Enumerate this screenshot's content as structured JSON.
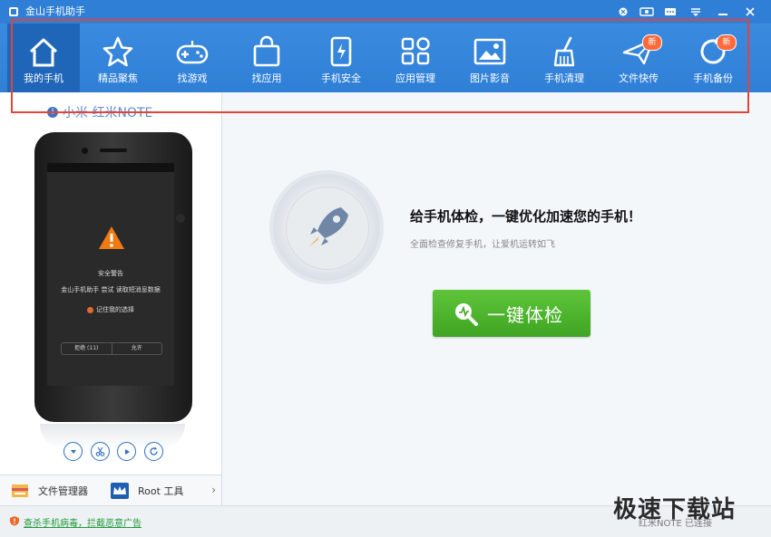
{
  "window": {
    "title": "金山手机助手",
    "controls": [
      "close-circle-icon",
      "skin-icon",
      "message-icon",
      "menu-icon",
      "minimize-icon",
      "close-icon"
    ]
  },
  "toolbar": {
    "items": [
      {
        "label": "我的手机",
        "icon": "home-icon",
        "active": true
      },
      {
        "label": "精品聚焦",
        "icon": "star-icon"
      },
      {
        "label": "找游戏",
        "icon": "gamepad-icon"
      },
      {
        "label": "找应用",
        "icon": "bag-icon"
      },
      {
        "label": "手机安全",
        "icon": "shield-phone-icon"
      },
      {
        "label": "应用管理",
        "icon": "apps-grid-icon"
      },
      {
        "label": "图片影音",
        "icon": "picture-icon"
      },
      {
        "label": "手机清理",
        "icon": "broom-icon"
      },
      {
        "label": "文件快传",
        "icon": "paper-plane-icon",
        "badge": "新"
      },
      {
        "label": "手机备份",
        "icon": "backup-icon",
        "badge": "新"
      }
    ]
  },
  "device": {
    "name": "小米 红米NOTE",
    "screen": {
      "alert_title": "安全警告",
      "alert_text": "金山手机助手 尝试 读取短消息数据",
      "remember": "记住我的选择",
      "deny": "拒绝 (11)",
      "allow": "允许"
    },
    "controls": [
      "down-icon",
      "scissors-icon",
      "play-icon",
      "refresh-icon"
    ]
  },
  "left_footer": {
    "file_manager": "文件管理器",
    "root_tool": "Root 工具",
    "arrow": "›"
  },
  "main": {
    "headline": "给手机体检，一键优化加速您的手机！",
    "subline": "全面检查修复手机，让爱机运转如飞",
    "cta_label": "一键体检"
  },
  "status": {
    "link": "查杀手机病毒，拦截恶意广告",
    "right_text": "红米NOTE 已连接"
  },
  "watermark": "极速下载站",
  "colors": {
    "titlebar": "#2f7fd6",
    "active_tab": "#1f66b8",
    "cta_green": "#4bb52c",
    "badge": "#ff6a3a",
    "annotation": "#e2443b"
  }
}
